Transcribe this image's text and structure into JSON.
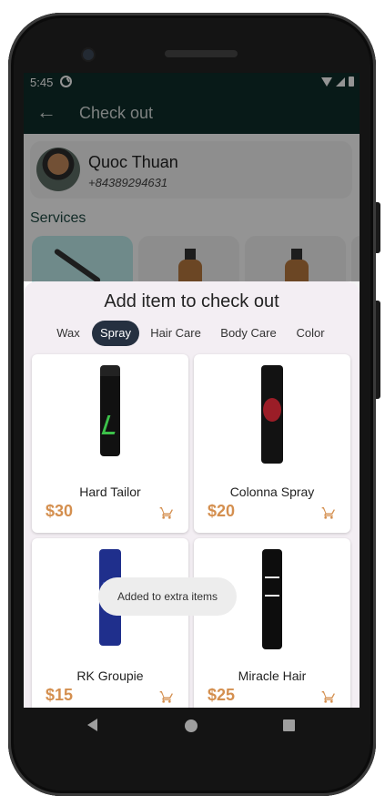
{
  "status": {
    "time": "5:45"
  },
  "appbar": {
    "back_icon": "arrow-left-icon",
    "title": "Check out"
  },
  "profile": {
    "name": "Quoc Thuan",
    "phone": "+84389294631"
  },
  "services": {
    "title": "Services"
  },
  "sheet": {
    "title": "Add item to check out",
    "tabs": [
      {
        "label": "Wax"
      },
      {
        "label": "Spray",
        "active": true
      },
      {
        "label": "Hair Care"
      },
      {
        "label": "Body Care"
      },
      {
        "label": "Color"
      }
    ],
    "products": [
      {
        "name": "Hard Tailor",
        "price": "$30"
      },
      {
        "name": "Colonna Spray",
        "price": "$20"
      },
      {
        "name": "RK Groupie",
        "price": "$15"
      },
      {
        "name": "Miracle Hair",
        "price": "$25"
      }
    ]
  },
  "toast": {
    "message": "Added to extra items"
  },
  "colors": {
    "appbar": "#0f2e2a",
    "price": "#d48f4f",
    "active_tab": "#253040"
  }
}
